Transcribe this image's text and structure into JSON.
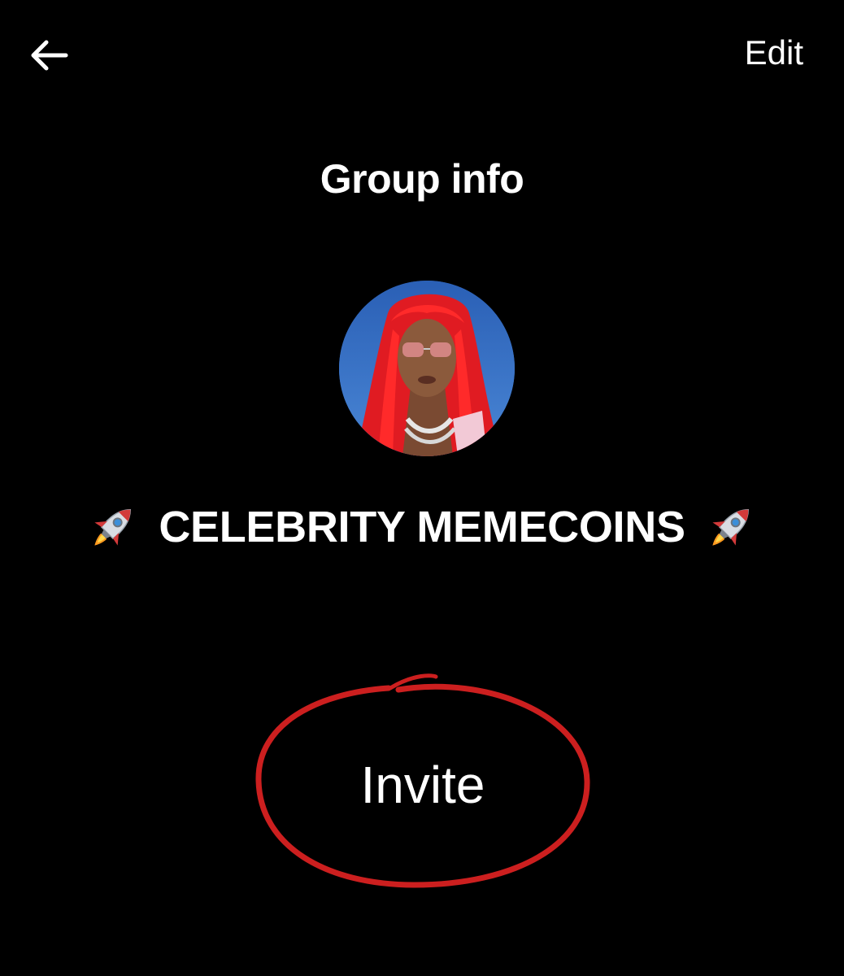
{
  "header": {
    "back_icon": "arrow-left-icon",
    "edit_label": "Edit"
  },
  "title": "Group info",
  "group": {
    "name": "CELEBRITY MEMECOINS",
    "leading_icon": "rocket-icon",
    "trailing_icon": "rocket-icon",
    "avatar": "group-avatar-photo"
  },
  "actions": {
    "invite_label": "Invite"
  },
  "annotation": {
    "circle_color": "#cc1f1f"
  }
}
